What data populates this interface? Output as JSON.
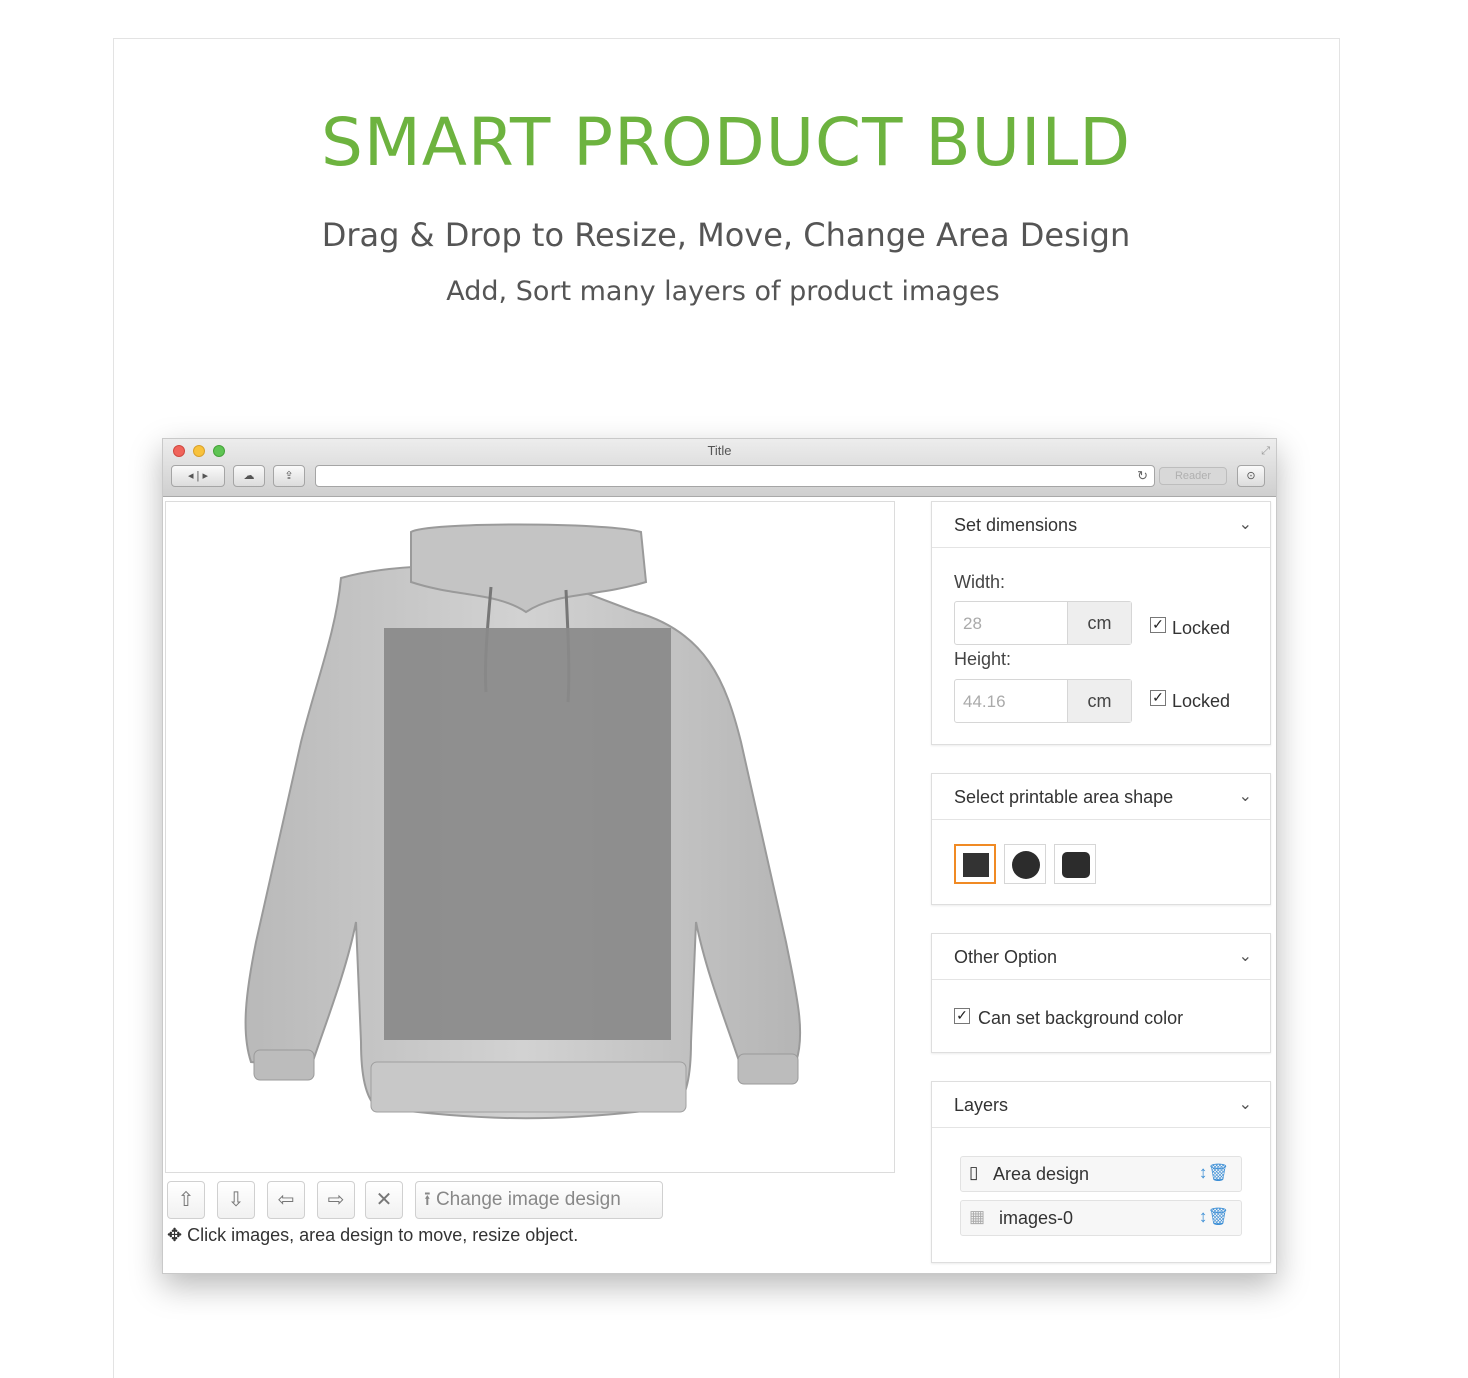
{
  "hero": {
    "title": "SMART PRODUCT BUILD",
    "subtitle": "Drag & Drop to Resize, Move, Change Area Design",
    "subtitle2": "Add, Sort many layers of product images"
  },
  "window": {
    "title": "Title",
    "reader_label": "Reader"
  },
  "toolbar": {
    "change_image_label": "Change image design",
    "hint": "Click images, area design to move, resize object."
  },
  "panels": {
    "dimensions": {
      "title": "Set dimensions",
      "width_label": "Width:",
      "width_value": "28",
      "width_unit": "cm",
      "width_locked_label": "Locked",
      "height_label": "Height:",
      "height_value": "44.16",
      "height_unit": "cm",
      "height_locked_label": "Locked"
    },
    "shape": {
      "title": "Select printable area shape",
      "options": [
        "square",
        "circle",
        "rounded-square"
      ],
      "selected": "square"
    },
    "other": {
      "title": "Other Option",
      "bg_color_label": "Can set background color"
    },
    "layers": {
      "title": "Layers",
      "items": [
        {
          "label": "Area design",
          "icon": "clipboard-icon"
        },
        {
          "label": "images-0",
          "icon": "image-icon"
        }
      ]
    }
  },
  "colors": {
    "accent_green": "#6db33f",
    "selected_shape_border": "#f08a24",
    "layer_action_blue": "#3d8fd6"
  }
}
